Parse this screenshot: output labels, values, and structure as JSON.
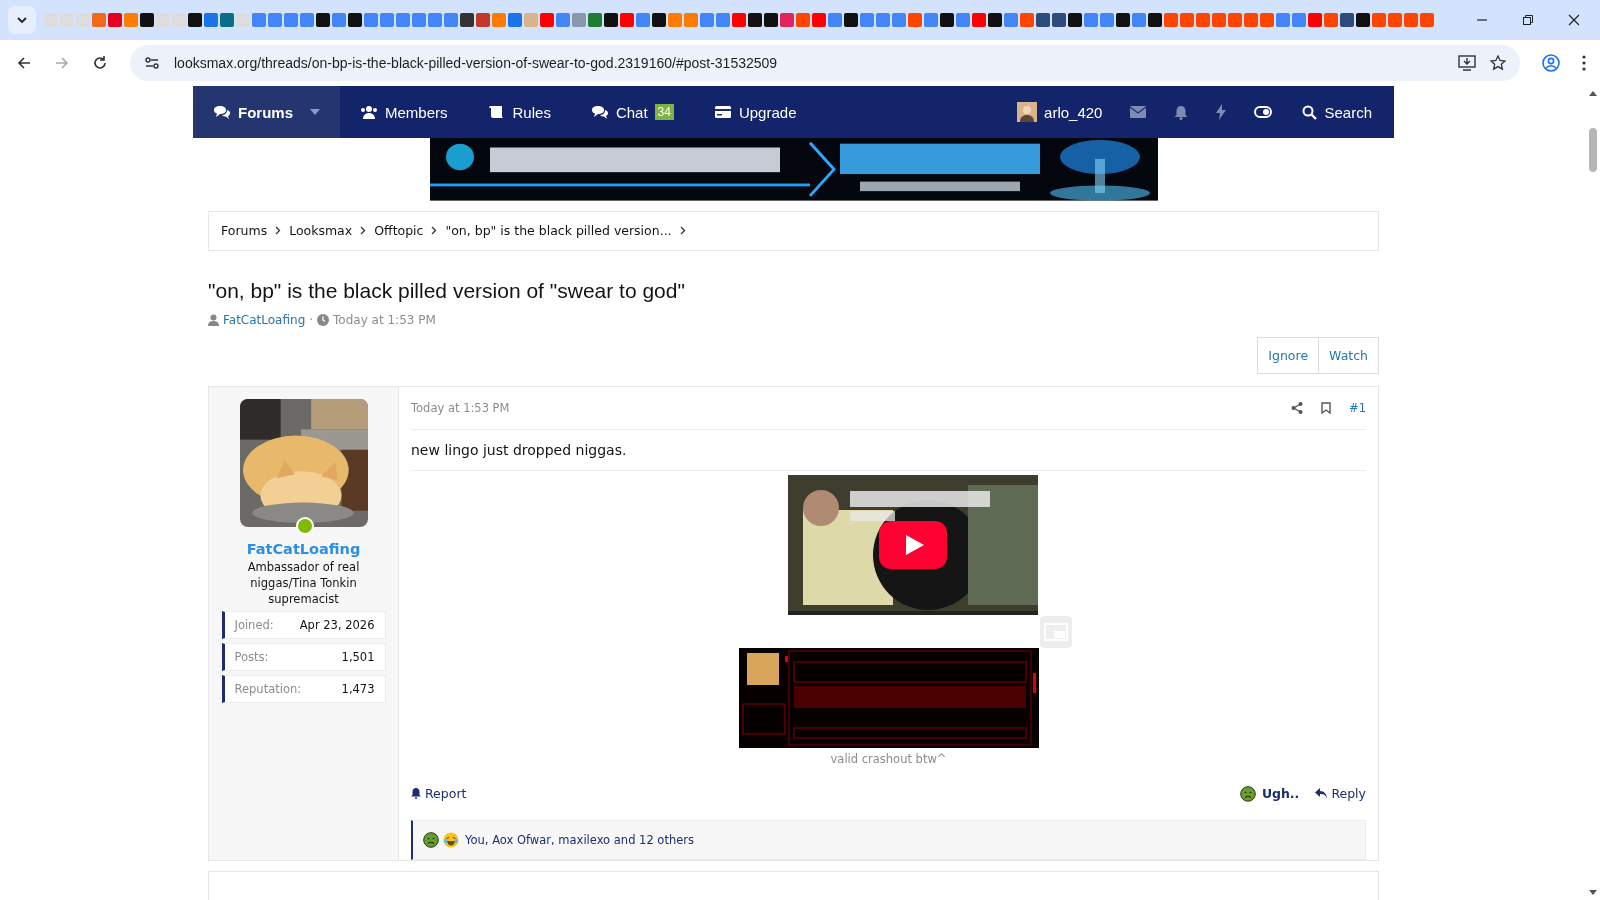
{
  "browser": {
    "url": "looksmax.org/threads/on-bp-is-the-black-pilled-version-of-swear-to-god.2319160/#post-31532509"
  },
  "nav": {
    "items": [
      {
        "kind": "forums",
        "label": "Forums",
        "selected": true
      },
      {
        "kind": "members",
        "label": "Members",
        "selected": false
      },
      {
        "kind": "rules",
        "label": "Rules",
        "selected": false
      },
      {
        "kind": "chat",
        "label": "Chat",
        "badge": "34",
        "selected": false
      },
      {
        "kind": "upgrade",
        "label": "Upgrade",
        "selected": false
      }
    ],
    "user": "arlo_420",
    "search": "Search"
  },
  "banner": {
    "kind": "picture"
  },
  "breadcrumbs": [
    "Forums",
    "Looksmax",
    "Offtopic",
    "\"on, bp\" is the black pilled version..."
  ],
  "thread": {
    "title": "\"on, bp\" is the black pilled version of \"swear to god\"",
    "author": "FatCatLoafing",
    "separator": "·",
    "date": "Today at 1:53 PM",
    "buttons": [
      "Ignore",
      "Watch"
    ]
  },
  "post": {
    "user": {
      "name": "FatCatLoafing",
      "online": true,
      "title": "Ambassador of real niggas/Tina Tonkin supremacist",
      "stats": [
        {
          "label": "Joined:",
          "value": "Apr 23, 2026"
        },
        {
          "label": "Posts:",
          "value": "1,501"
        },
        {
          "label": "Reputation:",
          "value": "1,473"
        }
      ]
    },
    "date": "Today at 1:53 PM",
    "number": "#1",
    "text": "new lingo just dropped niggas.",
    "caption": "valid crashout btw^",
    "report": "Report",
    "reaction": "Ugh..",
    "reply": "Reply",
    "reactions_summary": "You, Aox Ofwar, maxilexo and 12 others"
  }
}
